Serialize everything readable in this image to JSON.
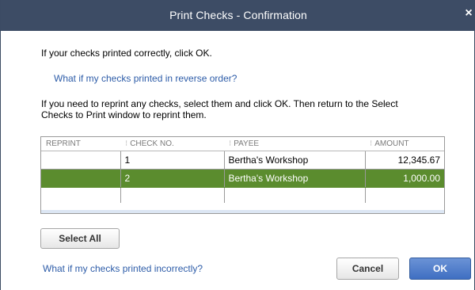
{
  "window": {
    "title": "Print Checks - Confirmation",
    "close_glyph": "×"
  },
  "messages": {
    "ok_line": "If your checks printed correctly, click OK.",
    "reverse_link": "What if my checks printed in reverse order?",
    "reprint_line1": "If you need to reprint any checks, select them and click OK. Then return to the Select",
    "reprint_line2": "Checks to Print window to reprint them."
  },
  "table": {
    "headers": [
      "REPRINT",
      "CHECK NO.",
      "PAYEE",
      "AMOUNT"
    ],
    "rows": [
      {
        "reprint": "",
        "check_no": "1",
        "payee": "Bertha's Workshop",
        "amount": "12,345.67",
        "selected": false
      },
      {
        "reprint": "",
        "check_no": "2",
        "payee": "Bertha's Workshop",
        "amount": "1,000.00",
        "selected": true
      }
    ]
  },
  "buttons": {
    "select_all": "Select All",
    "cancel": "Cancel",
    "ok": "OK"
  },
  "footer": {
    "incorrect_link": "What if my checks printed incorrectly?"
  },
  "colors": {
    "titlebar": "#3d4c65",
    "selected_row": "#5b8c2e",
    "link": "#2d5ca8",
    "ok_button": "#4a78c8"
  }
}
